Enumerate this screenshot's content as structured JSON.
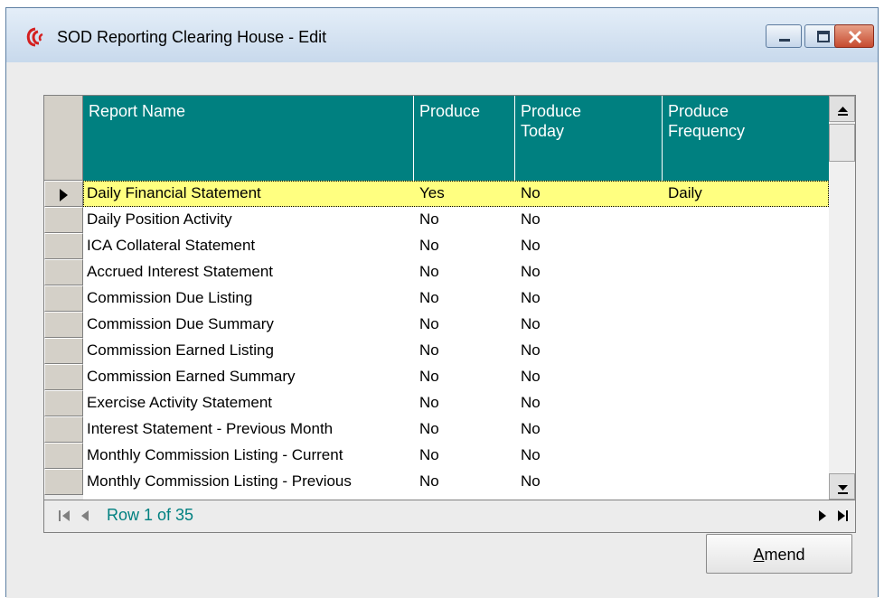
{
  "window": {
    "title": "SOD Reporting Clearing House - Edit"
  },
  "grid": {
    "columns": [
      {
        "label": "Report Name"
      },
      {
        "label": "Produce"
      },
      {
        "label": "Produce\nToday"
      },
      {
        "label": "Produce\nFrequency"
      }
    ],
    "rows": [
      {
        "name": "Daily Financial Statement",
        "produce": "Yes",
        "today": "No",
        "frequency": "Daily",
        "selected": true
      },
      {
        "name": "Daily Position Activity",
        "produce": "No",
        "today": "No",
        "frequency": ""
      },
      {
        "name": "ICA Collateral Statement",
        "produce": "No",
        "today": "No",
        "frequency": ""
      },
      {
        "name": "Accrued Interest Statement",
        "produce": "No",
        "today": "No",
        "frequency": ""
      },
      {
        "name": "Commission Due Listing",
        "produce": "No",
        "today": "No",
        "frequency": ""
      },
      {
        "name": "Commission Due Summary",
        "produce": "No",
        "today": "No",
        "frequency": ""
      },
      {
        "name": "Commission Earned Listing",
        "produce": "No",
        "today": "No",
        "frequency": ""
      },
      {
        "name": "Commission Earned Summary",
        "produce": "No",
        "today": "No",
        "frequency": ""
      },
      {
        "name": "Exercise Activity Statement",
        "produce": "No",
        "today": "No",
        "frequency": ""
      },
      {
        "name": "Interest Statement - Previous Month",
        "produce": "No",
        "today": "No",
        "frequency": ""
      },
      {
        "name": "Monthly Commission Listing - Current",
        "produce": "No",
        "today": "No",
        "frequency": ""
      },
      {
        "name": "Monthly Commission Listing - Previous",
        "produce": "No",
        "today": "No",
        "frequency": ""
      }
    ]
  },
  "navigator": {
    "text": "Row 1 of 35"
  },
  "buttons": {
    "amend_prefix": "A",
    "amend_rest": "mend"
  },
  "colors": {
    "header": "#008080",
    "selected_row": "#ffff80",
    "nav_text": "#008080"
  }
}
